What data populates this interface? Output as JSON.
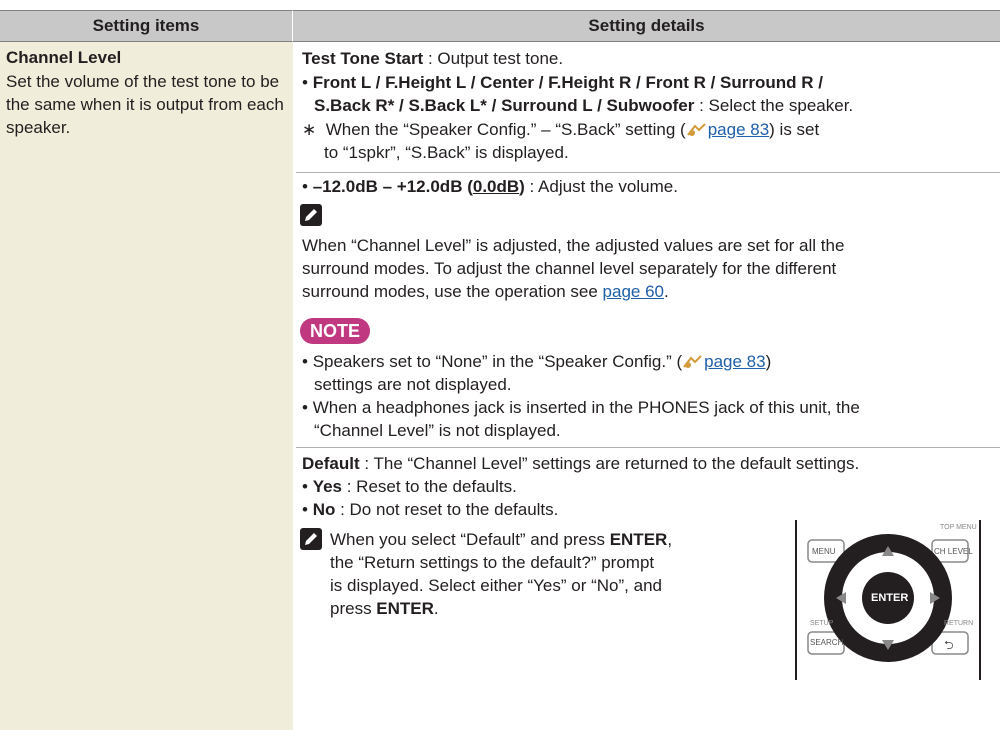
{
  "header": {
    "col1": "Setting items",
    "col2": "Setting details"
  },
  "item": {
    "title": "Channel Level",
    "desc": "Set the volume of the test tone to be the same when it is output from each speaker."
  },
  "details": {
    "test_tone_label": "Test Tone Start",
    "test_tone_text": " : Output test tone.",
    "speakers_line1": "Front L / F.Height L / Center / F.Height R / Front R / Surround R /",
    "speakers_line2_bold": "S.Back R* / S.Back L* / Surround L / Subwoofer",
    "speakers_line2_text": " : Select the speaker.",
    "footnote_a": "When the “Speaker Config.” – “S.Back” setting (",
    "footnote_link": "page 83",
    "footnote_b": ") is set",
    "footnote_c": "to “1spkr”, “S.Back” is displayed.",
    "range_bold": "–12.0dB – +12.0dB (",
    "range_default": "0.0dB",
    "range_close": ")",
    "range_text": " : Adjust the volume.",
    "memo_line1": "When “Channel Level” is adjusted, the adjusted values are set for all the",
    "memo_line2": "surround modes. To adjust the channel level separately for the different",
    "memo_line3a": "surround modes, use the operation see ",
    "memo_link": "page 60",
    "memo_line3b": ".",
    "note_label": "NOTE",
    "note1a": "Speakers set to “None” in the “Speaker Config.” (",
    "note1_link": "page 83",
    "note1b": ")",
    "note1c": "settings are not displayed.",
    "note2a": "When a headphones jack is inserted in the PHONES jack of this unit, the",
    "note2b": "“Channel Level” is not displayed.",
    "default_label": "Default",
    "default_text": " : The “Channel Level” settings are returned to the default settings.",
    "yes_label": "Yes",
    "yes_text": " : Reset to the defaults.",
    "no_label": "No",
    "no_text": " : Do not reset to the defaults.",
    "tip_line1a": "When you select “Default” and press ",
    "tip_enter": "ENTER",
    "tip_line1b": ",",
    "tip_line2": "the “Return settings to the default?” prompt",
    "tip_line3": "is displayed. Select either “Yes” or “No”, and",
    "tip_line4a": "press ",
    "tip_line4b": "."
  },
  "remote": {
    "top_menu": "TOP MENU",
    "menu": "MENU",
    "ch_level": "CH LEVEL",
    "enter": "ENTER",
    "setup": "SETUP",
    "search": "SEARCH",
    "return": "RETURN"
  }
}
